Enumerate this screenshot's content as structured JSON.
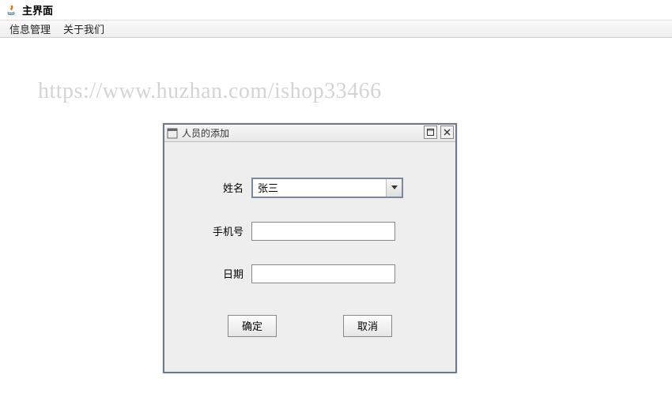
{
  "main": {
    "title": "主界面"
  },
  "menubar": {
    "items": [
      "信息管理",
      "关于我们"
    ]
  },
  "watermark": "https://www.huzhan.com/ishop33466",
  "dialog": {
    "title": "人员的添加",
    "form": {
      "name_label": "姓名",
      "name_value": "张三",
      "phone_label": "手机号",
      "phone_value": "",
      "date_label": "日期",
      "date_value": ""
    },
    "buttons": {
      "ok": "确定",
      "cancel": "取消"
    }
  }
}
